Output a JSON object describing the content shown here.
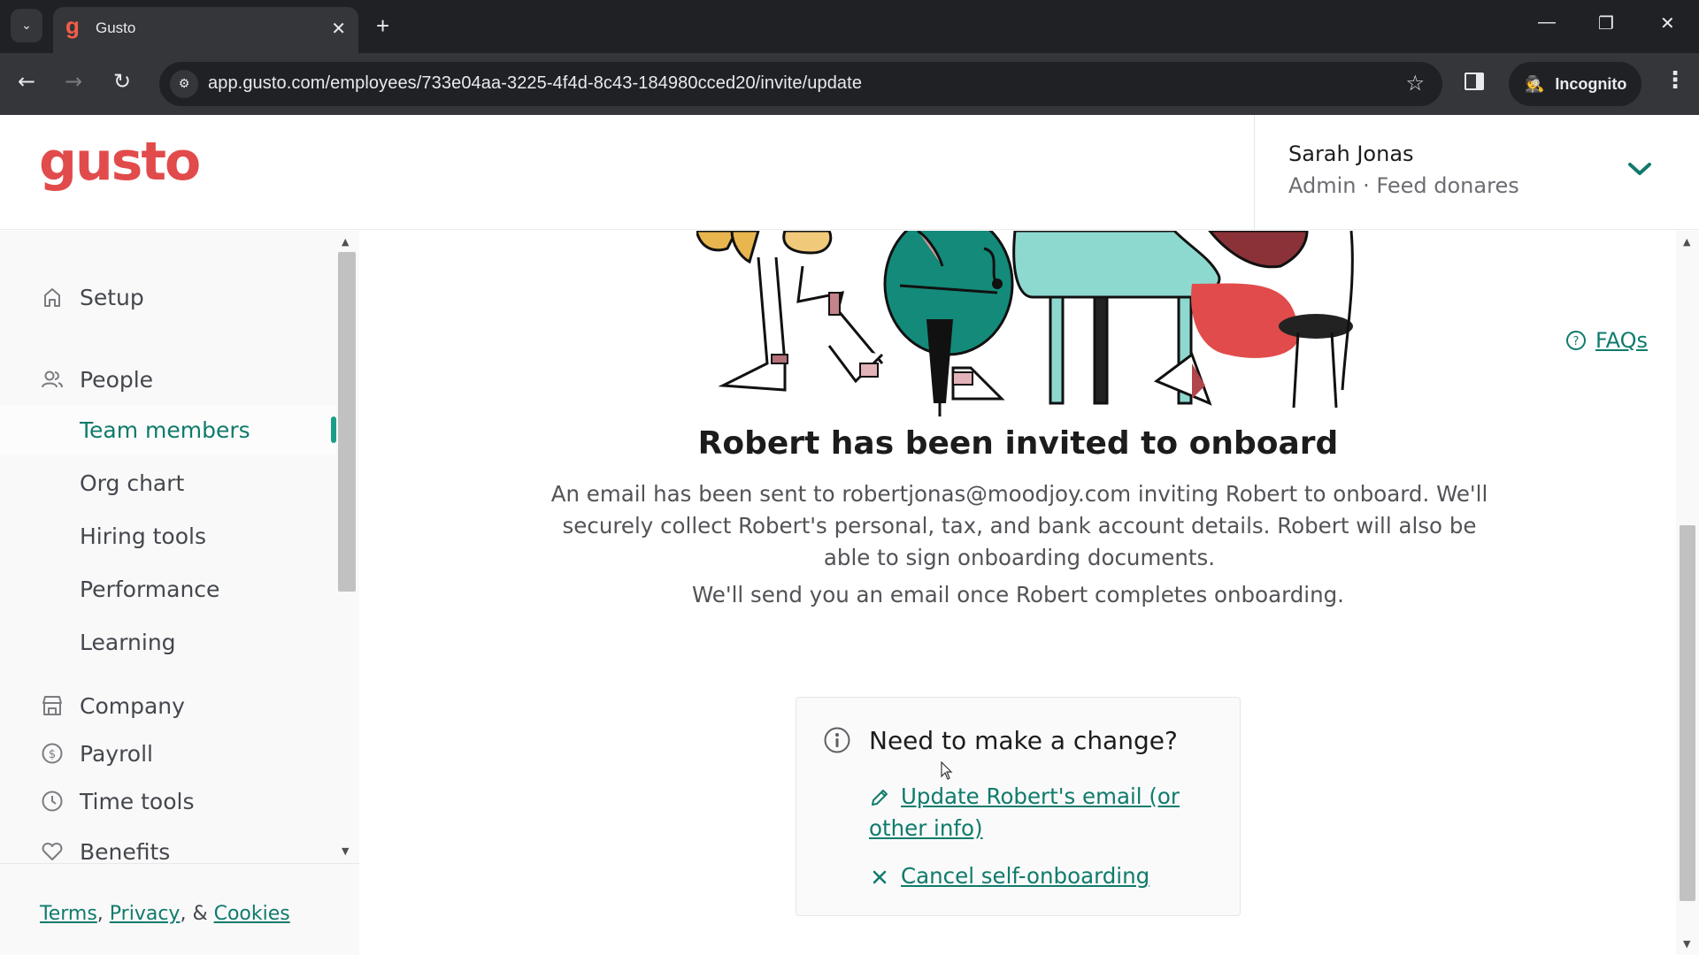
{
  "browser": {
    "tab_title": "Gusto",
    "favicon_letter": "g",
    "url": "app.gusto.com/employees/733e04aa-3225-4f4d-8c43-184980cced20/invite/update",
    "incognito_label": "Incognito",
    "icons": {
      "tab_search": "⌄",
      "close": "✕",
      "new_tab": "+",
      "minimize": "—",
      "restore": "❐",
      "window_close": "✕",
      "back": "←",
      "forward": "→",
      "reload": "↻",
      "site_info": "⚙",
      "star": "☆",
      "menu": "⋮",
      "incognito": "🕵"
    }
  },
  "header": {
    "logo": "gusto",
    "account": {
      "name": "Sarah Jonas",
      "role": "Admin · Feed donares"
    }
  },
  "sidebar": {
    "items": [
      {
        "label": "Setup",
        "icon": "home-icon"
      },
      {
        "label": "People",
        "icon": "people-icon"
      },
      {
        "label": "Team members",
        "sub": true,
        "active": true
      },
      {
        "label": "Org chart",
        "sub": true
      },
      {
        "label": "Hiring tools",
        "sub": true
      },
      {
        "label": "Performance",
        "sub": true
      },
      {
        "label": "Learning",
        "sub": true
      },
      {
        "label": "Company",
        "icon": "store-icon"
      },
      {
        "label": "Payroll",
        "icon": "dollar-icon"
      },
      {
        "label": "Time tools",
        "icon": "clock-icon"
      },
      {
        "label": "Benefits",
        "icon": "heart-icon"
      }
    ],
    "footer": {
      "terms": "Terms",
      "sep1": ", ",
      "privacy": "Privacy",
      "sep2": ", & ",
      "cookies": "Cookies"
    }
  },
  "main": {
    "faqs_label": "FAQs",
    "title": "Robert has been invited to onboard",
    "body": "An email has been sent to robertjonas@moodjoy.com inviting Robert to onboard. We'll securely collect Robert's personal, tax, and bank account details. Robert will also be able to sign onboarding documents.",
    "body2": "We'll send you an email once Robert completes onboarding.",
    "card": {
      "title": "Need to make a change?",
      "update_link": "Update Robert's email (or other info)",
      "cancel_link": "Cancel self-onboarding"
    }
  },
  "colors": {
    "brand_red": "#e24b4b",
    "accent_green": "#0f7b6c"
  }
}
